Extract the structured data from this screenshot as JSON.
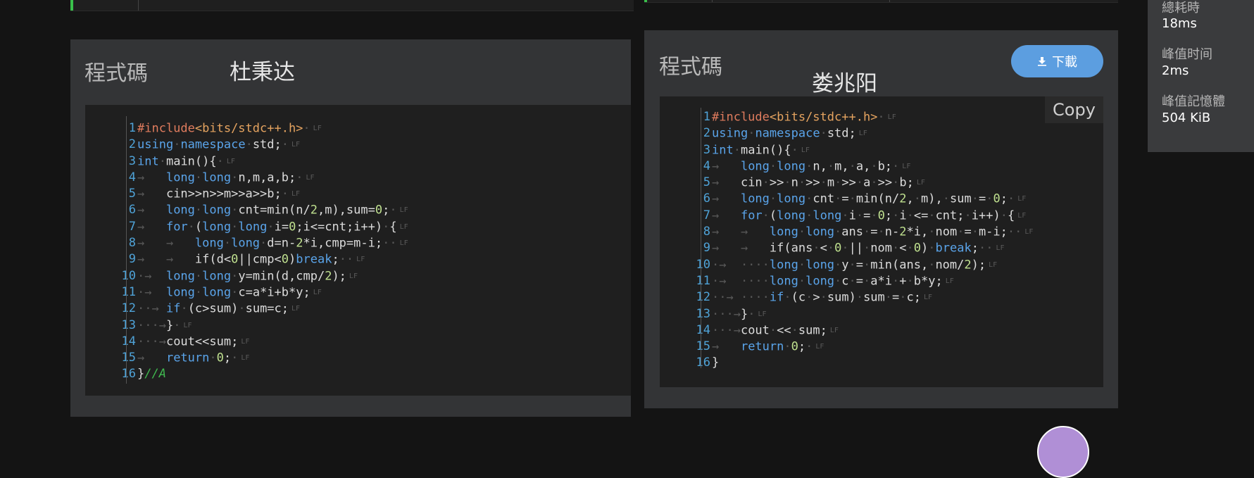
{
  "left_panel": {
    "title": "程式碼",
    "author": "杜秉达",
    "code_lines": [
      [
        [
          "#include",
          "tk-pp"
        ],
        [
          "<bits/stdc++.h>",
          "tk-inc"
        ],
        [
          "·",
          "ws"
        ]
      ],
      [
        [
          "using",
          "tk-kw"
        ],
        [
          "·",
          "ws"
        ],
        [
          "namespace",
          "tk-kw"
        ],
        [
          "·",
          "ws"
        ],
        [
          "std;",
          "tk-tx"
        ],
        [
          "·",
          "ws"
        ]
      ],
      [
        [
          "int",
          "tk-kw"
        ],
        [
          "·",
          "ws"
        ],
        [
          "main(){",
          "tk-tx"
        ],
        [
          "·",
          "ws"
        ]
      ],
      [
        [
          "→   ",
          "ws"
        ],
        [
          "long",
          "tk-kw"
        ],
        [
          "·",
          "ws"
        ],
        [
          "long",
          "tk-kw"
        ],
        [
          "·",
          "ws"
        ],
        [
          "n,m,a,b;",
          "tk-tx"
        ],
        [
          "·",
          "ws"
        ]
      ],
      [
        [
          "→   ",
          "ws"
        ],
        [
          "cin>>n>>m>>a>>b;",
          "tk-tx"
        ],
        [
          "·",
          "ws"
        ]
      ],
      [
        [
          "→   ",
          "ws"
        ],
        [
          "long",
          "tk-kw"
        ],
        [
          "·",
          "ws"
        ],
        [
          "long",
          "tk-kw"
        ],
        [
          "·",
          "ws"
        ],
        [
          "cnt=min(n/",
          "tk-tx"
        ],
        [
          "2",
          "tk-num"
        ],
        [
          ",m),sum=",
          "tk-tx"
        ],
        [
          "0",
          "tk-num"
        ],
        [
          ";",
          "tk-tx"
        ],
        [
          "·",
          "ws"
        ]
      ],
      [
        [
          "→   ",
          "ws"
        ],
        [
          "for",
          "tk-kw"
        ],
        [
          "·",
          "ws"
        ],
        [
          "(",
          "tk-tx"
        ],
        [
          "long",
          "tk-kw"
        ],
        [
          "·",
          "ws"
        ],
        [
          "long",
          "tk-kw"
        ],
        [
          "·",
          "ws"
        ],
        [
          "i=",
          "tk-tx"
        ],
        [
          "0",
          "tk-num"
        ],
        [
          ";i<=cnt;i++)",
          "tk-tx"
        ],
        [
          "·",
          "ws"
        ],
        [
          "{",
          "tk-tx"
        ]
      ],
      [
        [
          "→   →   ",
          "ws"
        ],
        [
          "long",
          "tk-kw"
        ],
        [
          "·",
          "ws"
        ],
        [
          "long",
          "tk-kw"
        ],
        [
          "·",
          "ws"
        ],
        [
          "d=n-",
          "tk-tx"
        ],
        [
          "2",
          "tk-num"
        ],
        [
          "*i,cmp=m-i;",
          "tk-tx"
        ],
        [
          "··",
          "ws"
        ]
      ],
      [
        [
          "→   →   ",
          "ws"
        ],
        [
          "if(d<",
          "tk-tx"
        ],
        [
          "0",
          "tk-num"
        ],
        [
          "||cmp<",
          "tk-tx"
        ],
        [
          "0",
          "tk-num"
        ],
        [
          ")",
          "tk-tx"
        ],
        [
          "break",
          "tk-kw"
        ],
        [
          ";",
          "tk-tx"
        ],
        [
          "··",
          "ws"
        ]
      ],
      [
        [
          "·→  ",
          "ws"
        ],
        [
          "long",
          "tk-kw"
        ],
        [
          "·",
          "ws"
        ],
        [
          "long",
          "tk-kw"
        ],
        [
          "·",
          "ws"
        ],
        [
          "y=min(d,cmp/",
          "tk-tx"
        ],
        [
          "2",
          "tk-num"
        ],
        [
          ");",
          "tk-tx"
        ]
      ],
      [
        [
          "·→  ",
          "ws"
        ],
        [
          "long",
          "tk-kw"
        ],
        [
          "·",
          "ws"
        ],
        [
          "long",
          "tk-kw"
        ],
        [
          "·",
          "ws"
        ],
        [
          "c=a*i+b*y;",
          "tk-tx"
        ]
      ],
      [
        [
          "··→ ",
          "ws"
        ],
        [
          "if",
          "tk-kw"
        ],
        [
          "·",
          "ws"
        ],
        [
          "(c>sum)",
          "tk-tx"
        ],
        [
          "·",
          "ws"
        ],
        [
          "sum=c;",
          "tk-tx"
        ]
      ],
      [
        [
          "···→",
          "ws"
        ],
        [
          "}",
          "tk-tx"
        ],
        [
          "·",
          "ws"
        ]
      ],
      [
        [
          "···→",
          "ws"
        ],
        [
          "cout<<sum;",
          "tk-tx"
        ]
      ],
      [
        [
          "→   ",
          "ws"
        ],
        [
          "return",
          "tk-kw"
        ],
        [
          "·",
          "ws"
        ],
        [
          "0",
          "tk-num"
        ],
        [
          ";",
          "tk-tx"
        ],
        [
          "·",
          "ws"
        ]
      ],
      [
        [
          "}",
          "tk-tx"
        ],
        [
          "//A",
          "tk-cm"
        ]
      ]
    ],
    "lf_lines": [
      true,
      true,
      true,
      true,
      true,
      true,
      true,
      true,
      true,
      true,
      true,
      true,
      true,
      true,
      true,
      false
    ]
  },
  "right_panel": {
    "title": "程式碼",
    "author": "娄兆阳",
    "download_label": "下載",
    "copy_label": "Copy",
    "code_lines": [
      [
        [
          "#include",
          "tk-pp"
        ],
        [
          "<bits/stdc++.h>",
          "tk-inc"
        ],
        [
          "·",
          "ws"
        ]
      ],
      [
        [
          "using",
          "tk-kw"
        ],
        [
          "·",
          "ws"
        ],
        [
          "namespace",
          "tk-kw"
        ],
        [
          "·",
          "ws"
        ],
        [
          "std;",
          "tk-tx"
        ]
      ],
      [
        [
          "int",
          "tk-kw"
        ],
        [
          "·",
          "ws"
        ],
        [
          "main(){",
          "tk-tx"
        ],
        [
          "·",
          "ws"
        ]
      ],
      [
        [
          "→   ",
          "ws"
        ],
        [
          "long",
          "tk-kw"
        ],
        [
          "·",
          "ws"
        ],
        [
          "long",
          "tk-kw"
        ],
        [
          "·",
          "ws"
        ],
        [
          "n,",
          "tk-tx"
        ],
        [
          "·",
          "ws"
        ],
        [
          "m,",
          "tk-tx"
        ],
        [
          "·",
          "ws"
        ],
        [
          "a,",
          "tk-tx"
        ],
        [
          "·",
          "ws"
        ],
        [
          "b;",
          "tk-tx"
        ],
        [
          "·",
          "ws"
        ]
      ],
      [
        [
          "→   ",
          "ws"
        ],
        [
          "cin",
          "tk-tx"
        ],
        [
          "·",
          "ws"
        ],
        [
          ">>",
          "tk-tx"
        ],
        [
          "·",
          "ws"
        ],
        [
          "n",
          "tk-tx"
        ],
        [
          "·",
          "ws"
        ],
        [
          ">>",
          "tk-tx"
        ],
        [
          "·",
          "ws"
        ],
        [
          "m",
          "tk-tx"
        ],
        [
          "·",
          "ws"
        ],
        [
          ">>",
          "tk-tx"
        ],
        [
          "·",
          "ws"
        ],
        [
          "a",
          "tk-tx"
        ],
        [
          "·",
          "ws"
        ],
        [
          ">>",
          "tk-tx"
        ],
        [
          "·",
          "ws"
        ],
        [
          "b;",
          "tk-tx"
        ]
      ],
      [
        [
          "→   ",
          "ws"
        ],
        [
          "long",
          "tk-kw"
        ],
        [
          "·",
          "ws"
        ],
        [
          "long",
          "tk-kw"
        ],
        [
          "·",
          "ws"
        ],
        [
          "cnt",
          "tk-tx"
        ],
        [
          "·",
          "ws"
        ],
        [
          "=",
          "tk-tx"
        ],
        [
          "·",
          "ws"
        ],
        [
          "min(n/",
          "tk-tx"
        ],
        [
          "2",
          "tk-num"
        ],
        [
          ",",
          "tk-tx"
        ],
        [
          "·",
          "ws"
        ],
        [
          "m),",
          "tk-tx"
        ],
        [
          "·",
          "ws"
        ],
        [
          "sum",
          "tk-tx"
        ],
        [
          "·",
          "ws"
        ],
        [
          "=",
          "tk-tx"
        ],
        [
          "·",
          "ws"
        ],
        [
          "0",
          "tk-num"
        ],
        [
          ";",
          "tk-tx"
        ],
        [
          "·",
          "ws"
        ]
      ],
      [
        [
          "→   ",
          "ws"
        ],
        [
          "for",
          "tk-kw"
        ],
        [
          "·",
          "ws"
        ],
        [
          "(",
          "tk-tx"
        ],
        [
          "long",
          "tk-kw"
        ],
        [
          "·",
          "ws"
        ],
        [
          "long",
          "tk-kw"
        ],
        [
          "·",
          "ws"
        ],
        [
          "i",
          "tk-tx"
        ],
        [
          "·",
          "ws"
        ],
        [
          "=",
          "tk-tx"
        ],
        [
          "·",
          "ws"
        ],
        [
          "0",
          "tk-num"
        ],
        [
          ";",
          "tk-tx"
        ],
        [
          "·",
          "ws"
        ],
        [
          "i",
          "tk-tx"
        ],
        [
          "·",
          "ws"
        ],
        [
          "<=",
          "tk-tx"
        ],
        [
          "·",
          "ws"
        ],
        [
          "cnt;",
          "tk-tx"
        ],
        [
          "·",
          "ws"
        ],
        [
          "i++)",
          "tk-tx"
        ],
        [
          "·",
          "ws"
        ],
        [
          "{",
          "tk-tx"
        ]
      ],
      [
        [
          "→   →   ",
          "ws"
        ],
        [
          "long",
          "tk-kw"
        ],
        [
          "·",
          "ws"
        ],
        [
          "long",
          "tk-kw"
        ],
        [
          "·",
          "ws"
        ],
        [
          "ans",
          "tk-tx"
        ],
        [
          "·",
          "ws"
        ],
        [
          "=",
          "tk-tx"
        ],
        [
          "·",
          "ws"
        ],
        [
          "n-",
          "tk-tx"
        ],
        [
          "2",
          "tk-num"
        ],
        [
          "*i,",
          "tk-tx"
        ],
        [
          "·",
          "ws"
        ],
        [
          "nom",
          "tk-tx"
        ],
        [
          "·",
          "ws"
        ],
        [
          "=",
          "tk-tx"
        ],
        [
          "·",
          "ws"
        ],
        [
          "m-i;",
          "tk-tx"
        ],
        [
          "··",
          "ws"
        ]
      ],
      [
        [
          "→   →   ",
          "ws"
        ],
        [
          "if(ans",
          "tk-tx"
        ],
        [
          "·",
          "ws"
        ],
        [
          "<",
          "tk-tx"
        ],
        [
          "·",
          "ws"
        ],
        [
          "0",
          "tk-num"
        ],
        [
          "·",
          "ws"
        ],
        [
          "||",
          "tk-tx"
        ],
        [
          "·",
          "ws"
        ],
        [
          "nom",
          "tk-tx"
        ],
        [
          "·",
          "ws"
        ],
        [
          "<",
          "tk-tx"
        ],
        [
          "·",
          "ws"
        ],
        [
          "0",
          "tk-num"
        ],
        [
          ")",
          "tk-tx"
        ],
        [
          "·",
          "ws"
        ],
        [
          "break",
          "tk-kw"
        ],
        [
          ";",
          "tk-tx"
        ],
        [
          "··",
          "ws"
        ]
      ],
      [
        [
          "·→  ····",
          "ws"
        ],
        [
          "long",
          "tk-kw"
        ],
        [
          "·",
          "ws"
        ],
        [
          "long",
          "tk-kw"
        ],
        [
          "·",
          "ws"
        ],
        [
          "y",
          "tk-tx"
        ],
        [
          "·",
          "ws"
        ],
        [
          "=",
          "tk-tx"
        ],
        [
          "·",
          "ws"
        ],
        [
          "min(ans,",
          "tk-tx"
        ],
        [
          "·",
          "ws"
        ],
        [
          "nom/",
          "tk-tx"
        ],
        [
          "2",
          "tk-num"
        ],
        [
          ");",
          "tk-tx"
        ]
      ],
      [
        [
          "·→  ····",
          "ws"
        ],
        [
          "long",
          "tk-kw"
        ],
        [
          "·",
          "ws"
        ],
        [
          "long",
          "tk-kw"
        ],
        [
          "·",
          "ws"
        ],
        [
          "c",
          "tk-tx"
        ],
        [
          "·",
          "ws"
        ],
        [
          "=",
          "tk-tx"
        ],
        [
          "·",
          "ws"
        ],
        [
          "a*i",
          "tk-tx"
        ],
        [
          "·",
          "ws"
        ],
        [
          "+",
          "tk-tx"
        ],
        [
          "·",
          "ws"
        ],
        [
          "b*y;",
          "tk-tx"
        ]
      ],
      [
        [
          "··→ ····",
          "ws"
        ],
        [
          "if",
          "tk-kw"
        ],
        [
          "·",
          "ws"
        ],
        [
          "(c",
          "tk-tx"
        ],
        [
          "·",
          "ws"
        ],
        [
          ">",
          "tk-tx"
        ],
        [
          "·",
          "ws"
        ],
        [
          "sum)",
          "tk-tx"
        ],
        [
          "·",
          "ws"
        ],
        [
          "sum",
          "tk-tx"
        ],
        [
          "·",
          "ws"
        ],
        [
          "=",
          "tk-tx"
        ],
        [
          "·",
          "ws"
        ],
        [
          "c;",
          "tk-tx"
        ]
      ],
      [
        [
          "···→",
          "ws"
        ],
        [
          "}",
          "tk-tx"
        ],
        [
          "·",
          "ws"
        ]
      ],
      [
        [
          "···→",
          "ws"
        ],
        [
          "cout",
          "tk-tx"
        ],
        [
          "·",
          "ws"
        ],
        [
          "<<",
          "tk-tx"
        ],
        [
          "·",
          "ws"
        ],
        [
          "sum;",
          "tk-tx"
        ]
      ],
      [
        [
          "→   ",
          "ws"
        ],
        [
          "return",
          "tk-kw"
        ],
        [
          "·",
          "ws"
        ],
        [
          "0",
          "tk-num"
        ],
        [
          ";",
          "tk-tx"
        ],
        [
          "·",
          "ws"
        ]
      ],
      [
        [
          "}",
          "tk-tx"
        ]
      ]
    ],
    "lf_lines": [
      true,
      true,
      true,
      true,
      true,
      true,
      true,
      true,
      true,
      true,
      true,
      true,
      true,
      true,
      true,
      false
    ]
  },
  "lf_marker": "LF",
  "stats": {
    "items": [
      {
        "label": "總耗時",
        "value": "18ms"
      },
      {
        "label": "峰值时间",
        "value": "2ms"
      },
      {
        "label": "峰值記憶體",
        "value": "504 KiB"
      }
    ]
  },
  "colors": {
    "accent_green": "#39c04a",
    "download_button": "#5c9ee0",
    "line_number": "#4fa3d8"
  },
  "icons": {
    "download": "download-icon"
  }
}
